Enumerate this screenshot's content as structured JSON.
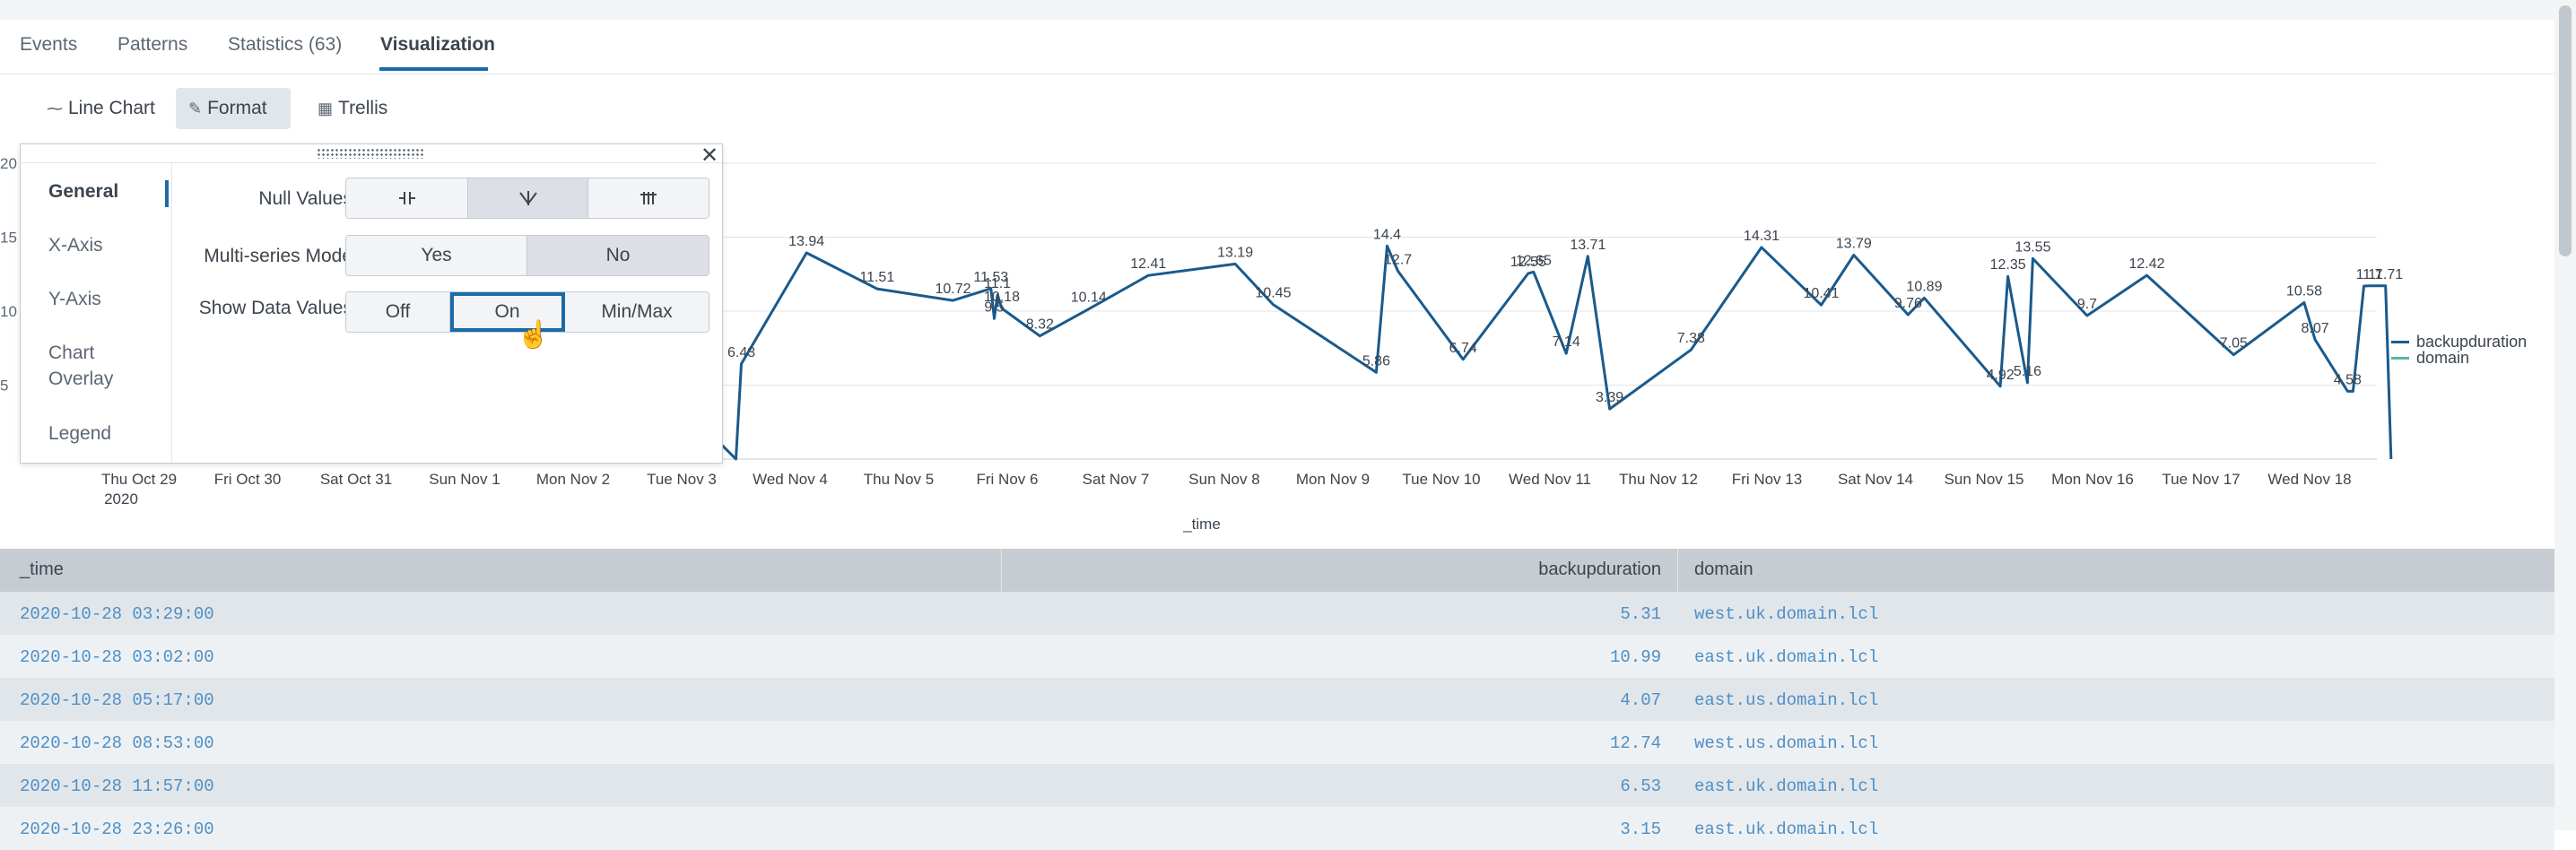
{
  "tabs": [
    {
      "label": "Events"
    },
    {
      "label": "Patterns"
    },
    {
      "label": "Statistics (63)"
    },
    {
      "label": "Visualization"
    }
  ],
  "controls": {
    "chart_type": "Line Chart",
    "format": "Format",
    "trellis": "Trellis"
  },
  "format_panel": {
    "nav": [
      "General",
      "X-Axis",
      "Y-Axis",
      "Chart Overlay",
      "Legend"
    ],
    "null_values_label": "Null Values",
    "multiseries_label": "Multi-series Mode",
    "multiseries_options": [
      "Yes",
      "No"
    ],
    "multiseries_selected": "No",
    "show_data_values_label": "Show Data Values",
    "show_data_values_options": [
      "Off",
      "On",
      "Min/Max"
    ],
    "show_data_values_selected": "On",
    "close_icon": "close-icon",
    "drag_icon": "drag-handle-icon"
  },
  "chart_data": {
    "type": "line",
    "xlabel": "_time",
    "x": [
      "Thu Oct 29 2020",
      "Fri Oct 30",
      "Sat Oct 31",
      "Sun Nov 1",
      "Mon Nov 2",
      "Tue Nov 3",
      "Wed Nov 4",
      "Thu Nov 5",
      "Fri Nov 6",
      "Sat Nov 7",
      "Sun Nov 8",
      "Mon Nov 9",
      "Tue Nov 10",
      "Wed Nov 11",
      "Thu Nov 12",
      "Fri Nov 13",
      "Sat Nov 14",
      "Sun Nov 15",
      "Mon Nov 16",
      "Tue Nov 17",
      "Wed Nov 18"
    ],
    "x_ticks": [
      "Thu Oct 29",
      "Fri Oct 30",
      "Sat Oct 31",
      "Sun Nov 1",
      "Mon Nov 2",
      "Tue Nov 3",
      "Wed Nov 4",
      "Thu Nov 5",
      "Fri Nov 6",
      "Sat Nov 7",
      "Sun Nov 8",
      "Mon Nov 9",
      "Tue Nov 10",
      "Wed Nov 11",
      "Thu Nov 12",
      "Fri Nov 13",
      "Sat Nov 14",
      "Sun Nov 15",
      "Mon Nov 16",
      "Tue Nov 17",
      "Wed Nov 18"
    ],
    "x_tick_sub": "2020",
    "y_ticks": [
      "20",
      "15",
      "10",
      "5"
    ],
    "ylim": [
      0,
      20
    ],
    "grid": true,
    "legend_position": "right",
    "series": [
      {
        "name": "backupduration",
        "color": "#1a5a8c",
        "points": [
          [
            5.2,
            2.2
          ],
          [
            5.5,
            0
          ],
          [
            5.55,
            6.43
          ],
          [
            6.15,
            13.94
          ],
          [
            6.8,
            11.51
          ],
          [
            7.5,
            10.72
          ],
          [
            7.85,
            11.53
          ],
          [
            7.88,
            9.5
          ],
          [
            7.91,
            11.1
          ],
          [
            7.95,
            10.18
          ],
          [
            8.3,
            8.32
          ],
          [
            8.75,
            10.14
          ],
          [
            9.3,
            12.41
          ],
          [
            10.1,
            13.19
          ],
          [
            10.45,
            10.45
          ],
          [
            11.4,
            5.86
          ],
          [
            11.5,
            14.4
          ],
          [
            11.6,
            12.7
          ],
          [
            12.2,
            6.74
          ],
          [
            12.8,
            12.55
          ],
          [
            12.85,
            12.65
          ],
          [
            13.15,
            7.14
          ],
          [
            13.35,
            13.71
          ],
          [
            13.55,
            3.39
          ],
          [
            14.3,
            7.38
          ],
          [
            14.95,
            14.31
          ],
          [
            15.5,
            10.41
          ],
          [
            15.8,
            13.79
          ],
          [
            16.3,
            9.76
          ],
          [
            16.45,
            10.89
          ],
          [
            17.15,
            4.92
          ],
          [
            17.22,
            12.35
          ],
          [
            17.4,
            5.16
          ],
          [
            17.45,
            13.55
          ],
          [
            17.95,
            9.7
          ],
          [
            18.5,
            12.42
          ],
          [
            19.3,
            7.05
          ],
          [
            19.95,
            10.58
          ],
          [
            20.05,
            8.07
          ],
          [
            20.35,
            4.58
          ],
          [
            20.4,
            4.58
          ],
          [
            20.5,
            11.7
          ],
          [
            20.55,
            11.71
          ],
          [
            20.7,
            11.71
          ],
          [
            20.75,
            0
          ]
        ],
        "labels": [
          {
            "text": "6.43",
            "i": 2
          },
          {
            "text": "13.94",
            "i": 3
          },
          {
            "text": "11.51",
            "i": 4
          },
          {
            "text": "10.72",
            "i": 5
          },
          {
            "text": "11.53",
            "i": 6
          },
          {
            "text": "9.5",
            "i": 7
          },
          {
            "text": "11.1",
            "i": 8
          },
          {
            "text": "10.18",
            "i": 9
          },
          {
            "text": "8.32",
            "i": 10
          },
          {
            "text": "10.14",
            "i": 11
          },
          {
            "text": "12.41",
            "i": 12
          },
          {
            "text": "13.19",
            "i": 13
          },
          {
            "text": "10.45",
            "i": 14
          },
          {
            "text": "5.86",
            "i": 15
          },
          {
            "text": "14.4",
            "i": 16
          },
          {
            "text": "12.7",
            "i": 17
          },
          {
            "text": "6.74",
            "i": 18
          },
          {
            "text": "12.55",
            "i": 19
          },
          {
            "text": "12.65",
            "i": 20
          },
          {
            "text": "7.14",
            "i": 21
          },
          {
            "text": "13.71",
            "i": 22
          },
          {
            "text": "3.39",
            "i": 23
          },
          {
            "text": "7.38",
            "i": 24
          },
          {
            "text": "14.31",
            "i": 25
          },
          {
            "text": "10.41",
            "i": 26
          },
          {
            "text": "13.79",
            "i": 27
          },
          {
            "text": "9.76",
            "i": 28
          },
          {
            "text": "10.89",
            "i": 29
          },
          {
            "text": "4.92",
            "i": 30
          },
          {
            "text": "12.35",
            "i": 31
          },
          {
            "text": "5.16",
            "i": 32
          },
          {
            "text": "13.55",
            "i": 33
          },
          {
            "text": "9.7",
            "i": 34
          },
          {
            "text": "12.42",
            "i": 35
          },
          {
            "text": "7.05",
            "i": 36
          },
          {
            "text": "10.58",
            "i": 37
          },
          {
            "text": "8.07",
            "i": 38
          },
          {
            "text": "4.58",
            "i": 39
          },
          {
            "text": "11.7",
            "i": 42
          },
          {
            "text": "11.71",
            "i": 43
          }
        ]
      },
      {
        "name": "domain",
        "color": "#5ab3ad",
        "values": []
      }
    ]
  },
  "table": {
    "columns": [
      "_time",
      "backupduration",
      "domain"
    ],
    "rows": [
      [
        "2020-10-28 03:29:00",
        "5.31",
        "west.uk.domain.lcl"
      ],
      [
        "2020-10-28 03:02:00",
        "10.99",
        "east.uk.domain.lcl"
      ],
      [
        "2020-10-28 05:17:00",
        "4.07",
        "east.us.domain.lcl"
      ],
      [
        "2020-10-28 08:53:00",
        "12.74",
        "west.us.domain.lcl"
      ],
      [
        "2020-10-28 11:57:00",
        "6.53",
        "east.uk.domain.lcl"
      ],
      [
        "2020-10-28 23:26:00",
        "3.15",
        "east.uk.domain.lcl"
      ]
    ]
  }
}
